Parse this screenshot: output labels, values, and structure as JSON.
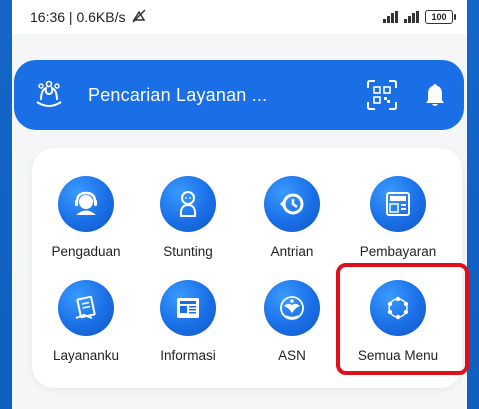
{
  "status_bar": {
    "time_speed": "16:36 | 0.6KB/s",
    "battery": "100"
  },
  "search": {
    "placeholder": "Pencarian Layanan ..."
  },
  "menu": {
    "items": [
      {
        "label": "Pengaduan",
        "icon": "customer-service-icon"
      },
      {
        "label": "Stunting",
        "icon": "baby-icon"
      },
      {
        "label": "Antrian",
        "icon": "history-clock-icon"
      },
      {
        "label": "Pembayaran",
        "icon": "atm-icon"
      },
      {
        "label": "Layananku",
        "icon": "document-hand-icon"
      },
      {
        "label": "Informasi",
        "icon": "news-icon"
      },
      {
        "label": "ASN",
        "icon": "garuda-emblem-icon"
      },
      {
        "label": "Semua Menu",
        "icon": "all-menu-circle-icon"
      }
    ]
  },
  "colors": {
    "primary": "#1a6fe6",
    "highlight": "#e0101a",
    "background": "#1565c8"
  }
}
